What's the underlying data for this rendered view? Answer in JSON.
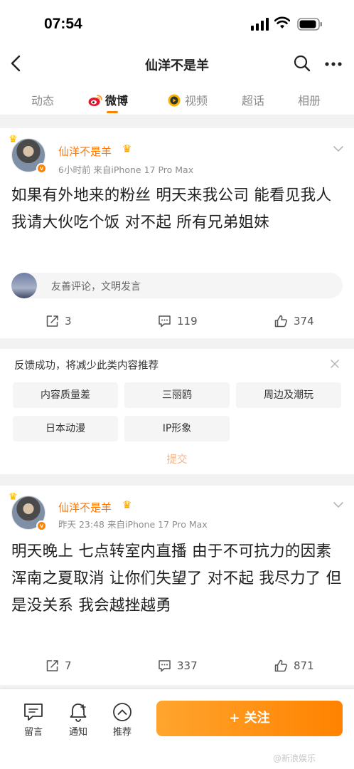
{
  "status_bar": {
    "time": "07:54"
  },
  "nav": {
    "title": "仙洋不是羊"
  },
  "tabs": [
    {
      "label": "动态"
    },
    {
      "label": "微博"
    },
    {
      "label": "视频"
    },
    {
      "label": "超话"
    },
    {
      "label": "相册"
    }
  ],
  "posts": [
    {
      "author": "仙洋不是羊",
      "meta": "6小时前  来自iPhone 17 Pro Max",
      "text": "如果有外地来的粉丝 明天来我公司 能看见我人 我请大伙吃个饭 对不起 所有兄弟姐妹",
      "comment_placeholder": "友善评论，文明发言",
      "reposts": "3",
      "comments": "119",
      "likes": "374"
    },
    {
      "author": "仙洋不是羊",
      "meta": "昨天 23:48  来自iPhone 17 Pro Max",
      "text": "明天晚上 七点转室内直播 由于不可抗力的因素 浑南之夏取消 让你们失望了 对不起 我尽力了 但是没关系 我会越挫越勇",
      "reposts": "7",
      "comments": "337",
      "likes": "871"
    }
  ],
  "feedback": {
    "title": "反馈成功，将减少此类内容推荐",
    "options": [
      "内容质量差",
      "三丽鸥",
      "周边及潮玩",
      "日本动漫",
      "IP形象"
    ],
    "submit": "提交"
  },
  "bottom_bar": {
    "message": "留言",
    "notify": "通知",
    "recommend": "推荐",
    "follow": "+ 关注"
  },
  "watermark": "@新浪娱乐"
}
